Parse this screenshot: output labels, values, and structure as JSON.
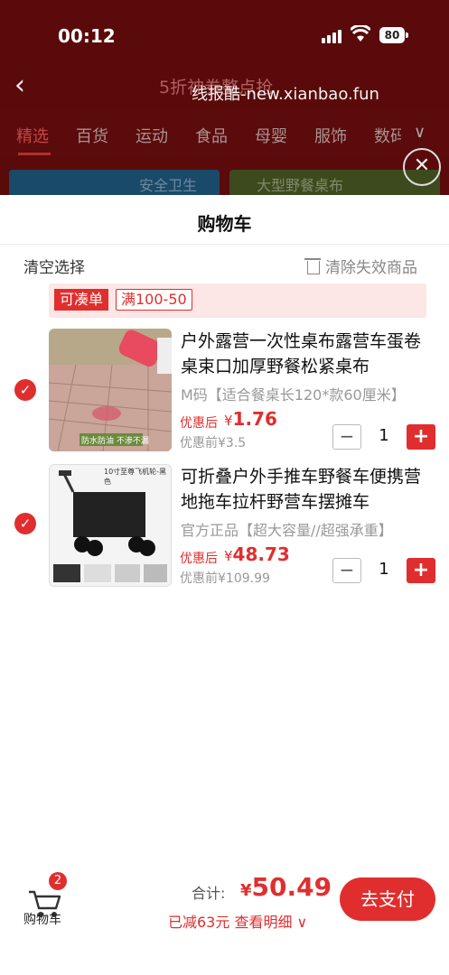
{
  "status_bar": {
    "time": "00:12",
    "battery": "80"
  },
  "nav": {
    "title": "5折神券整点抢",
    "watermark": "线报酷-new.xianbao.fun"
  },
  "categories": [
    "精选",
    "百货",
    "运动",
    "食品",
    "母婴",
    "服饰",
    "数码"
  ],
  "banners": [
    "安全卫生",
    "大型野餐桌布"
  ],
  "sheet": {
    "title": "购物车",
    "clear_selection": "清空选择",
    "clear_invalid": "清除失效商品",
    "promo_tag": "可凑单",
    "promo_rule": "满100-50"
  },
  "items": [
    {
      "name": "户外露营一次性桌布露营车蛋卷桌束口加厚野餐松紧桌布",
      "spec": "M码【适合餐桌长120*款60厘米】",
      "price_label": "优惠后",
      "currency": "¥",
      "price": "1.76",
      "original": "优惠前¥3.5",
      "qty": "1",
      "thumb_caption": "防水防油 不渗不漏"
    },
    {
      "name": "可折叠户外手推车野餐车便携营地拖车拉杆野营车摆摊车",
      "spec": "官方正品【超大容量//超强承重】",
      "price_label": "优惠后",
      "currency": "¥",
      "price": "48.73",
      "original": "优惠前¥109.99",
      "qty": "1",
      "thumb_caption": "10寸至尊飞机轮-黑色"
    }
  ],
  "footer": {
    "cart_label": "购物车",
    "cart_count": "2",
    "total_label": "合计:",
    "currency": "¥",
    "total": "50.49",
    "discount": "已减63元 查看明细",
    "pay_button": "去支付"
  },
  "colors": {
    "accent": "#e02e2e",
    "header_bg": "#5a0a0a"
  }
}
